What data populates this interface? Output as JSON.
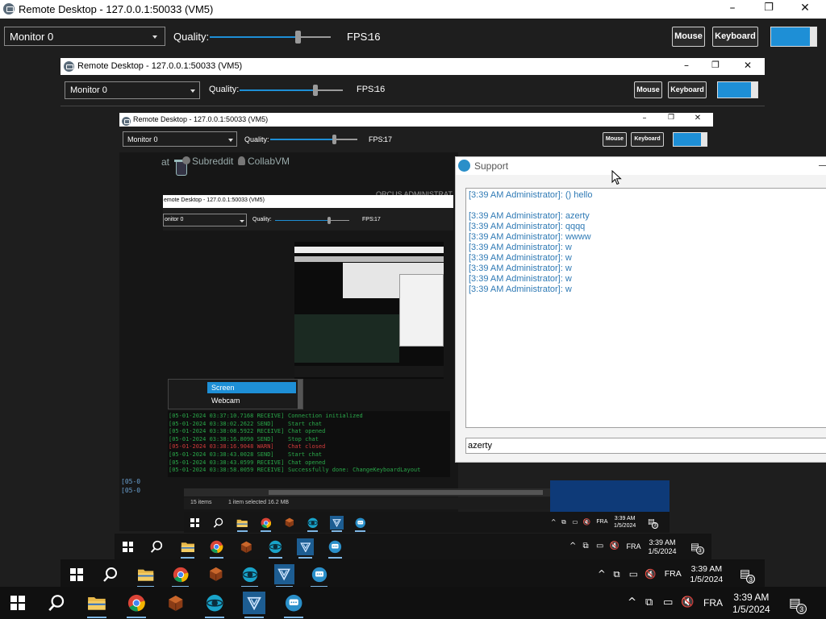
{
  "window": {
    "title": "Remote Desktop - 127.0.0.1:50033 (VM5)",
    "minimize_glyph": "–",
    "maximize_glyph": "❐",
    "close_glyph": "✕"
  },
  "toolbar": {
    "monitor_value": "Monitor 0",
    "quality_label": "Quality:",
    "quality_value": 0.8,
    "fps_label": "FPS:",
    "fps_value": "16",
    "mouse_label": "Mouse",
    "keyboard_label": "Keyboard"
  },
  "nested1": {
    "title": "Remote Desktop - 127.0.0.1:50033 (VM5)",
    "monitor_value": "Monitor 0",
    "quality_label": "Quality:",
    "fps_label": "FPS:",
    "fps_value": "16",
    "mouse_label": "Mouse",
    "keyboard_label": "Keyboard"
  },
  "nested2": {
    "title": "Remote Desktop - 127.0.0.1:50033 (VM5)",
    "monitor_value": "Monitor 0",
    "quality_label": "Quality:",
    "fps_label": "FPS:",
    "fps_value": "17",
    "mouse_label": "Mouse",
    "keyboard_label": "Keyboard"
  },
  "nested3": {
    "title": "emote Desktop - 127.0.0.1:50033 (VM5)",
    "monitor_value": "onitor 0",
    "quality_label": "Quality:",
    "fps_label": "FPS:",
    "fps_value": "17"
  },
  "desktop_bar": {
    "item1": "at",
    "item2": "Subreddit",
    "item3": "CollabVM",
    "admin_text": "ORCUS ADMINISTRAT"
  },
  "capture_menu": {
    "items": [
      "Screen",
      "Webcam"
    ]
  },
  "event_log": [
    {
      "time": "[05-01-2024 03:37:10.7168 RECEIVE]",
      "msg": "Connection initialized",
      "color": "#2aa84a"
    },
    {
      "time": "[05-01-2024 03:38:02.2622 SEND]",
      "msg": "Start chat",
      "color": "#2aa84a"
    },
    {
      "time": "[05-01-2024 03:38:08.5922 RECEIVE]",
      "msg": "Chat opened",
      "color": "#2aa84a"
    },
    {
      "time": "[05-01-2024 03:38:16.8090 SEND]",
      "msg": "Stop chat",
      "color": "#2aa84a"
    },
    {
      "time": "[05-01-2024 03:38:16.9048 WARN]",
      "msg": "Chat closed",
      "color": "#d23b3b"
    },
    {
      "time": "[05-01-2024 03:38:43.0028 SEND]",
      "msg": "Start chat",
      "color": "#2aa84a"
    },
    {
      "time": "[05-01-2024 03:38:43.0599 RECEIVE]",
      "msg": "Chat opened",
      "color": "#2aa84a"
    },
    {
      "time": "[05-01-2024 03:38:58.0059 RECEIVE]",
      "msg": "Successfully done: ChangeKeyboardLayout",
      "color": "#2aa84a"
    }
  ],
  "side_log": [
    "[05-0",
    "[05-0"
  ],
  "explorer_status": {
    "items": "15 items",
    "selected": "1 item selected  16.2 MB"
  },
  "support": {
    "title": "Support",
    "messages": [
      "[3:39 AM Administrator]: ()   hello",
      "",
      "[3:39 AM Administrator]: azerty",
      "[3:39 AM Administrator]: qqqq",
      "[3:39 AM Administrator]: wwww",
      "[3:39 AM Administrator]: w",
      "[3:39 AM Administrator]: w",
      "[3:39 AM Administrator]: w",
      "[3:39 AM Administrator]: w",
      "[3:39 AM Administrator]: w"
    ],
    "input_value": "azerty"
  },
  "taskbar": {
    "language": "FRA",
    "time": "3:39 AM",
    "date": "1/5/2024",
    "notifications": "3"
  },
  "colors": {
    "accent": "#1e8fd6",
    "chat_text": "#2f7ab5",
    "background": "#1e1e1e"
  }
}
